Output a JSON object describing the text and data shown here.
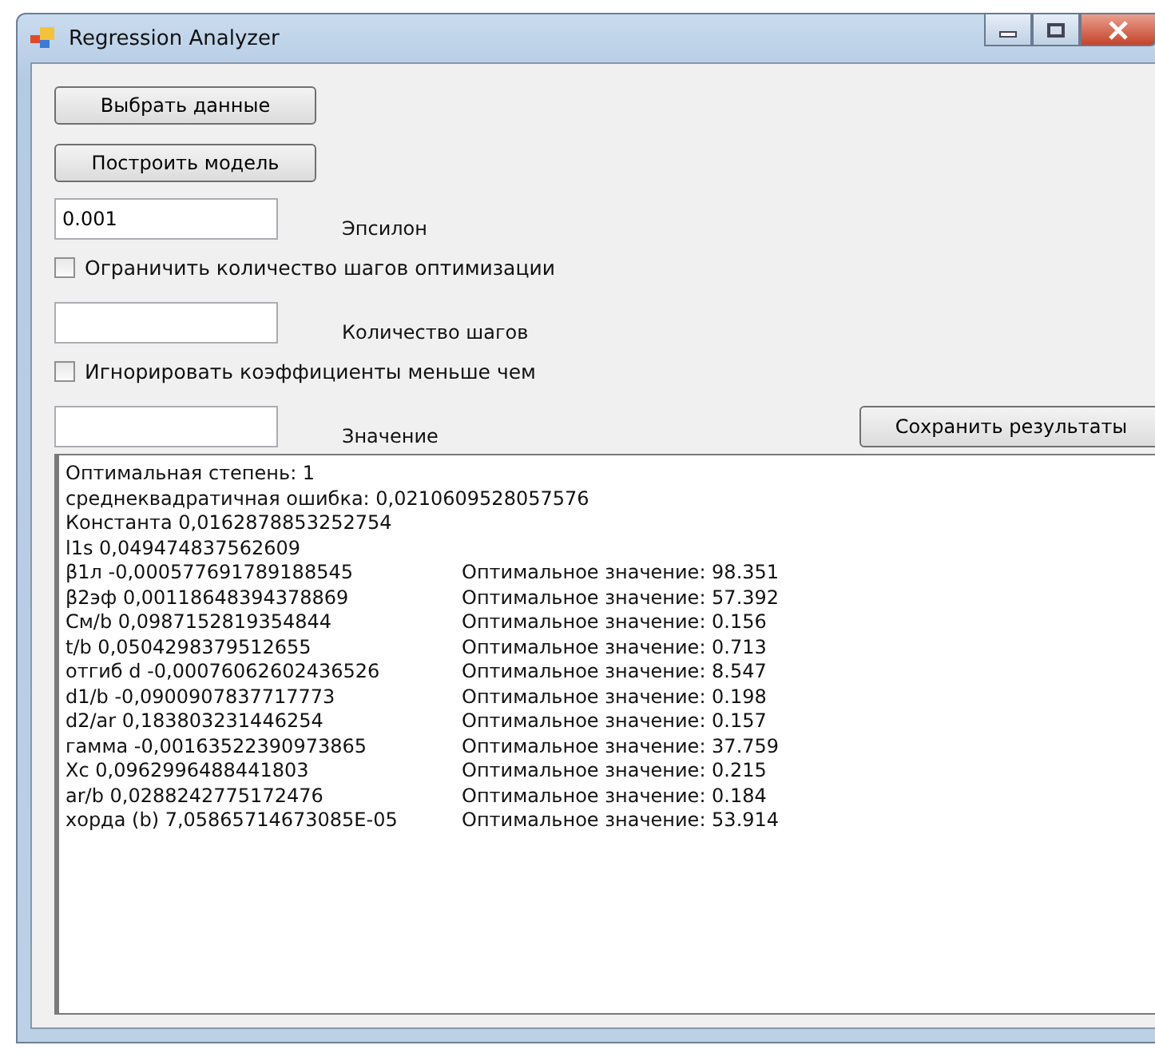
{
  "window": {
    "title": "Regression Analyzer"
  },
  "buttons": [
    "Выбрать данные",
    "Построить модель"
  ],
  "epsilon": {
    "value": "0.001",
    "label": "Эпсилон"
  },
  "limit_steps": {
    "label": "Ограничить количество шагов оптимизации",
    "checked": false
  },
  "steps": {
    "label": "Количество шагов"
  },
  "ignore_small": {
    "label": "Игнорировать коэффициенты меньше чем",
    "checked": false
  },
  "threshold": {
    "label": "Значение"
  },
  "save_button": "Сохранить результаты",
  "results": [
    {
      "text": "Оптимальная степень: 1"
    },
    {
      "text": "среднеквадратичная ошибка: 0,0210609528057576"
    },
    {
      "text": "Константа 0,0162878853252754"
    },
    {
      "text": "l1s 0,049474837562609"
    },
    {
      "text": "β1л -0,000577691789188545",
      "optimal": "Оптимальное значение: 98.351"
    },
    {
      "text": "β2эф 0,00118648394378869",
      "optimal": "Оптимальное значение: 57.392"
    },
    {
      "text": "Cм/b 0,0987152819354844",
      "optimal": "Оптимальное значение: 0.156"
    },
    {
      "text": "t/b 0,0504298379512655",
      "optimal": "Оптимальное значение: 0.713"
    },
    {
      "text": "отгиб d -0,00076062602436526",
      "optimal": "Оптимальное значение: 8.547"
    },
    {
      "text": "d1/b -0,0900907837717773",
      "optimal": "Оптимальное значение: 0.198"
    },
    {
      "text": "d2/ar 0,183803231446254",
      "optimal": "Оптимальное значение: 0.157"
    },
    {
      "text": "гамма -0,00163522390973865",
      "optimal": "Оптимальное значение: 37.759"
    },
    {
      "text": "Xc 0,0962996488441803",
      "optimal": "Оптимальное значение: 0.215"
    },
    {
      "text": "ar/b 0,0288242775172476",
      "optimal": "Оптимальное значение: 0.184"
    },
    {
      "text": "хорда (b) 7,05865714673085E-05",
      "optimal": "Оптимальное значение: 53.914"
    }
  ]
}
